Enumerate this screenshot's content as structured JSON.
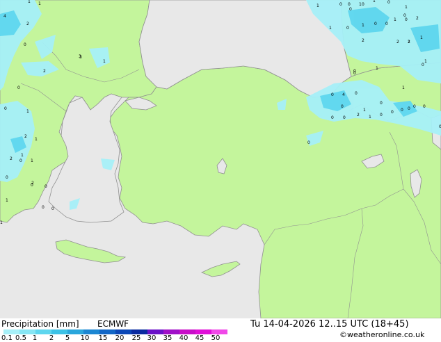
{
  "footer": {
    "title": "Precipitation [mm]",
    "model": "ECMWF",
    "datetime": "Tu 14-04-2026 12..15 UTC (18+45)",
    "credit": "©weatheronline.co.uk"
  },
  "legend": {
    "ticks": [
      "0.1",
      "0.5",
      "1",
      "2",
      "5",
      "10",
      "15",
      "20",
      "25",
      "30",
      "35",
      "40",
      "45",
      "50"
    ],
    "colors": [
      "#a6f0f8",
      "#86e6f4",
      "#5ed6ee",
      "#3cc2e6",
      "#2aa6dc",
      "#1b86d2",
      "#1266c6",
      "#0a46b6",
      "#0a2aa0",
      "#6a12c8",
      "#a010c8",
      "#c80ec8",
      "#e00ed8",
      "#f048e8"
    ]
  },
  "colors": {
    "sea": "#e8e8e8",
    "land": "#c4f59c",
    "coast": "#909090",
    "precip_light": "#a6f0f8",
    "precip_medium": "#5ed6ee"
  },
  "map": {
    "precip_labels": [
      "4",
      "1",
      "1",
      "3",
      "2",
      "0",
      "2",
      "0",
      "1",
      "0",
      "1",
      "2",
      "1",
      "2",
      "0",
      "1",
      "1",
      "0",
      "0",
      "0",
      "2",
      "1",
      "0",
      "0",
      "1",
      "1",
      "0",
      "0",
      "1",
      "1",
      "0",
      "0",
      "1",
      "1",
      "0",
      "0",
      "1",
      "0",
      "2",
      "1",
      "0",
      "3",
      "2",
      "2",
      "1",
      "1",
      "1",
      "0",
      "1",
      "1",
      "0",
      "4",
      "0",
      "1",
      "0",
      "0",
      "0",
      "2",
      "1",
      "0",
      "0",
      "0",
      "0",
      "0",
      "0",
      "0",
      "0",
      "0",
      "0",
      "0",
      "2",
      "0",
      "0"
    ]
  }
}
